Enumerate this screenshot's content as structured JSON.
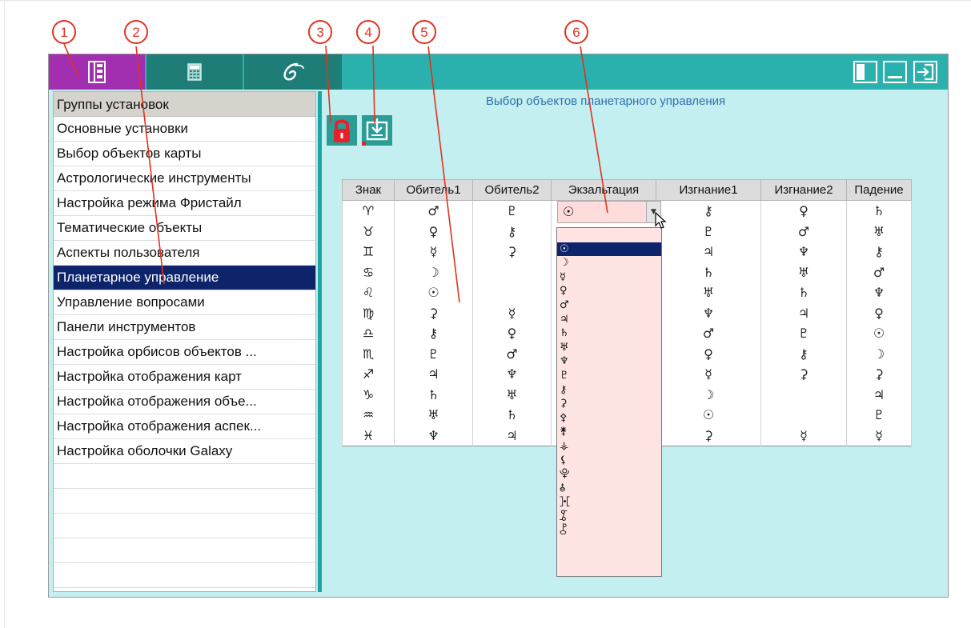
{
  "callouts": [
    "1",
    "2",
    "3",
    "4",
    "5",
    "6"
  ],
  "window": {
    "tabs": [
      {
        "icon": "settings-tree-icon"
      },
      {
        "icon": "calculator-icon"
      },
      {
        "icon": "galaxy-logo-icon"
      }
    ],
    "buttons": [
      {
        "icon": "panel-toggle-icon"
      },
      {
        "icon": "minimize-icon"
      },
      {
        "icon": "exit-icon"
      }
    ]
  },
  "left_panel": {
    "header": "Группы установок",
    "items": [
      "Основные установки",
      "Выбор объектов карты",
      "Астрологические инструменты",
      "Настройка режима Фристайл",
      "Тематические объекты",
      "Аспекты пользователя",
      "Планетарное управление",
      "Управление вопросами",
      "Панели инструментов",
      "Настройка орбисов объектов ...",
      "Настройка отображения карт",
      "Настройка отображения объе...",
      "Настройка отображения аспек...",
      "Настройка оболочки Galaxy"
    ],
    "selected_index": 6
  },
  "main": {
    "title": "Выбор объектов планетарного управления",
    "toolbar": [
      {
        "icon": "lock-icon"
      },
      {
        "icon": "save-table-icon"
      }
    ],
    "table": {
      "headers": [
        "Знак",
        "Обитель1",
        "Обитель2",
        "Экзальтация",
        "Изгнание1",
        "Изгнание2",
        "Падение"
      ],
      "rows": [
        [
          "♈",
          "♂",
          "♇",
          "☉",
          "⚷",
          "♀",
          "♄"
        ],
        [
          "♉",
          "♀",
          "⚷",
          "",
          "♇",
          "♂",
          "♅"
        ],
        [
          "♊",
          "☿",
          "⚳",
          "",
          "♃",
          "♆",
          "⚷"
        ],
        [
          "♋",
          "☽",
          "",
          "",
          "♄",
          "♅",
          "♂"
        ],
        [
          "♌",
          "☉",
          "",
          "",
          "♅",
          "♄",
          "♆"
        ],
        [
          "♍",
          "⚳",
          "☿",
          "",
          "♆",
          "♃",
          "♀"
        ],
        [
          "♎",
          "⚷",
          "♀",
          "",
          "♂",
          "♇",
          "☉"
        ],
        [
          "♏",
          "♇",
          "♂",
          "",
          "♀",
          "⚷",
          "☽"
        ],
        [
          "♐",
          "♃",
          "♆",
          "",
          "☿",
          "⚳",
          "⚳"
        ],
        [
          "♑",
          "♄",
          "♅",
          "",
          "☽",
          "",
          "♃"
        ],
        [
          "♒",
          "♅",
          "♄",
          "",
          "☉",
          "",
          "♇"
        ],
        [
          "♓",
          "♆",
          "♃",
          "",
          "⚳",
          "☿",
          "☿"
        ]
      ]
    },
    "combo_value": "☉",
    "dropdown_items": [
      "",
      "☉",
      "☽",
      "☿",
      "♀",
      "♂",
      "♃",
      "♄",
      "♅",
      "♆",
      "♇",
      "⚷",
      "⚳",
      "⚴",
      "⚵",
      "⚶",
      "⚸",
      "⯓",
      "⯗",
      "⯘",
      "⯙",
      "⯛"
    ],
    "dropdown_selected_index": 1
  },
  "colors": {
    "titlebar": "#2bb1ad",
    "tab_active": "#a22fb0",
    "tab_inactive": "#1f7d77",
    "panel_bg": "#c4eff0",
    "selection": "#0d246b",
    "callout": "#e0321e",
    "dropdown_bg": "#ffe4e4"
  }
}
